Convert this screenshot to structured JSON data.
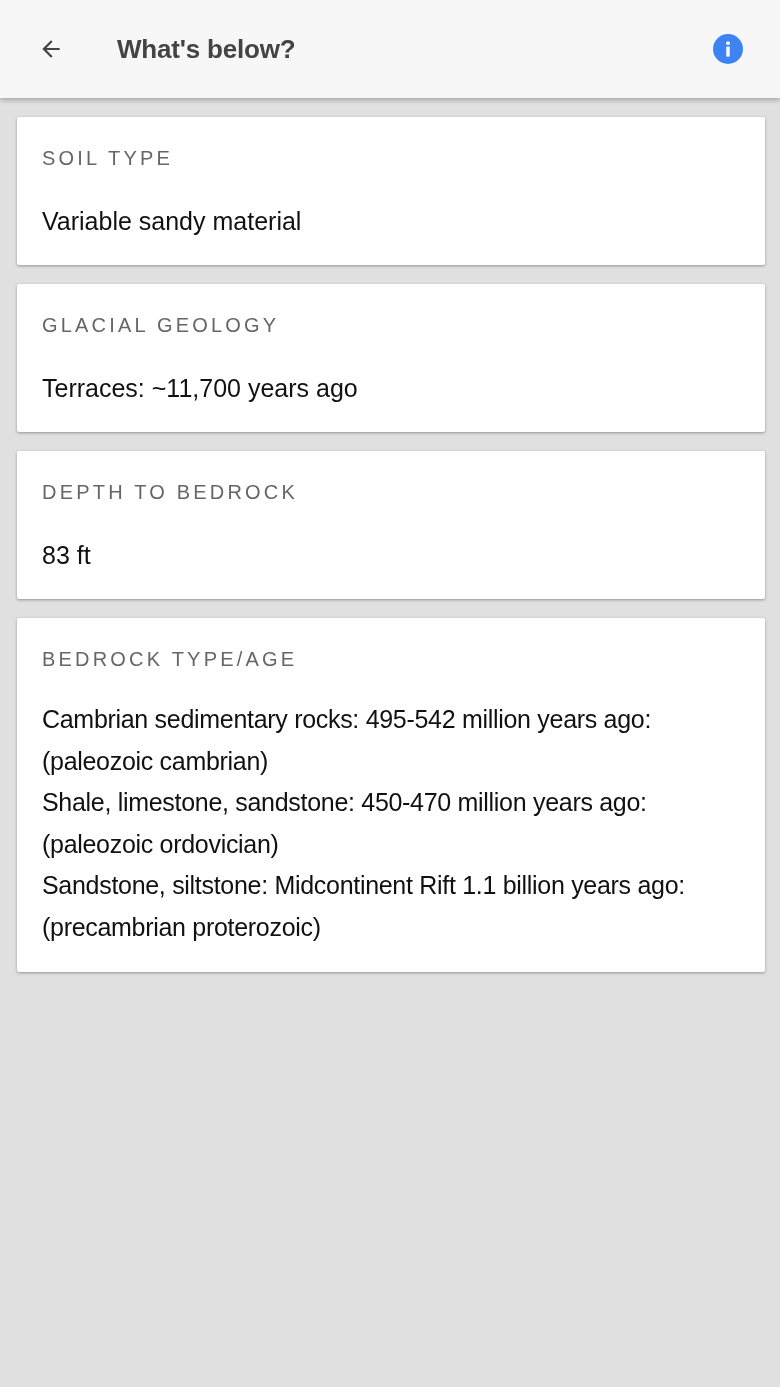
{
  "app_bar": {
    "title": "What's below?"
  },
  "cards": [
    {
      "kind": "value",
      "label": "SOIL TYPE",
      "value": "Variable sandy material"
    },
    {
      "kind": "value",
      "label": "GLACIAL GEOLOGY",
      "value": "Terraces: ~11,700 years ago"
    },
    {
      "kind": "value",
      "label": "DEPTH TO BEDROCK",
      "value": "83 ft"
    },
    {
      "kind": "entries",
      "label": "BEDROCK TYPE/AGE",
      "entries": [
        {
          "rock": "Cambrian sedimentary rocks: 495-542 million years ago:",
          "period": "(paleozoic cambrian)"
        },
        {
          "rock": "Shale, limestone, sandstone: 450-470 million years ago:",
          "period": "(paleozoic ordovician)"
        },
        {
          "rock": "Sandstone, siltstone: Midcontinent Rift 1.1 billion years ago:",
          "period": "(precambrian proterozoic)"
        }
      ]
    }
  ]
}
